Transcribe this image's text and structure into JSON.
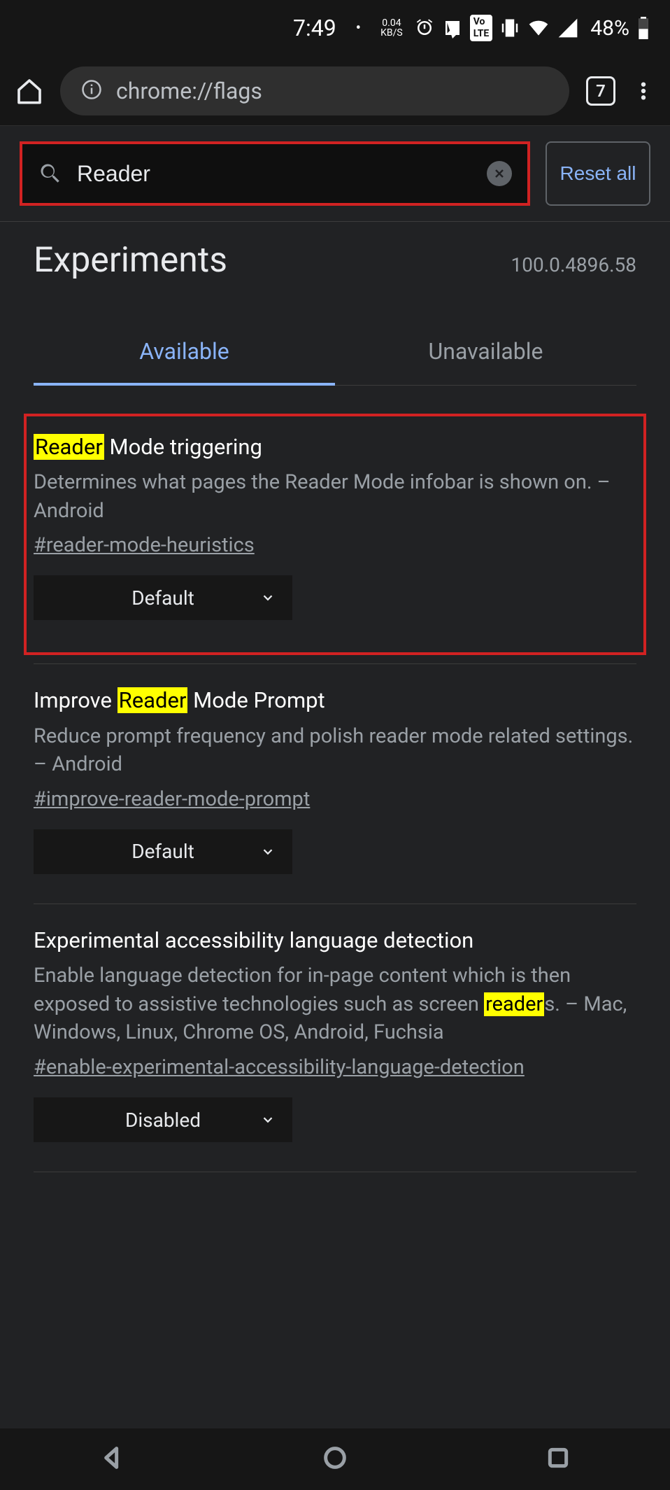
{
  "status": {
    "time": "7:49",
    "net_speed": "0.04",
    "net_unit": "KB/S",
    "battery": "48%"
  },
  "browser": {
    "url": "chrome://flags",
    "tab_count": "7"
  },
  "search": {
    "value": "Reader",
    "reset_label": "Reset all"
  },
  "page": {
    "heading": "Experiments",
    "version": "100.0.4896.58",
    "tab_available": "Available",
    "tab_unavailable": "Unavailable"
  },
  "flags": [
    {
      "title_pre": "",
      "title_hl": "Reader",
      "title_post": " Mode triggering",
      "desc_pre": "Determines what pages the Reader Mode infobar is shown on. – Android",
      "desc_hl": "",
      "desc_post": "",
      "hash": "#reader-mode-heuristics",
      "dropdown": "Default"
    },
    {
      "title_pre": "Improve ",
      "title_hl": "Reader",
      "title_post": " Mode Prompt",
      "desc_pre": "Reduce prompt frequency and polish reader mode related settings. – Android",
      "desc_hl": "",
      "desc_post": "",
      "hash": "#improve-reader-mode-prompt",
      "dropdown": "Default"
    },
    {
      "title_pre": "Experimental accessibility language detection",
      "title_hl": "",
      "title_post": "",
      "desc_pre": "Enable language detection for in-page content which is then exposed to assistive technologies such as screen ",
      "desc_hl": "reader",
      "desc_post": "s. – Mac, Windows, Linux, Chrome OS, Android, Fuchsia",
      "hash": "#enable-experimental-accessibility-language-detection",
      "dropdown": "Disabled"
    }
  ]
}
